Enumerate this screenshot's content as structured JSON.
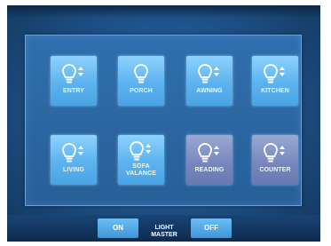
{
  "lights": [
    {
      "label": "ENTRY",
      "state": "on",
      "dimmable": true
    },
    {
      "label": "PORCH",
      "state": "on",
      "dimmable": false
    },
    {
      "label": "AWNING",
      "state": "on",
      "dimmable": true
    },
    {
      "label": "KITCHEN",
      "state": "on",
      "dimmable": true
    },
    {
      "label": "LIVING",
      "state": "on",
      "dimmable": true
    },
    {
      "label_line1": "SOFA",
      "label_line2": "VALANCE",
      "state": "on",
      "dimmable": true
    },
    {
      "label": "READING",
      "state": "off",
      "dimmable": true
    },
    {
      "label": "COUNTER",
      "state": "off",
      "dimmable": true
    }
  ],
  "master": {
    "on_label": "ON",
    "title_line1": "LIGHT",
    "title_line2": "MASTER",
    "off_label": "OFF"
  },
  "colors": {
    "button_on": "#5cb3ef",
    "button_off": "#7686bd",
    "background": "#1d4f86"
  },
  "icons": {
    "bulb": "light-bulb-icon",
    "dim": "dimmer-arrows-icon"
  }
}
